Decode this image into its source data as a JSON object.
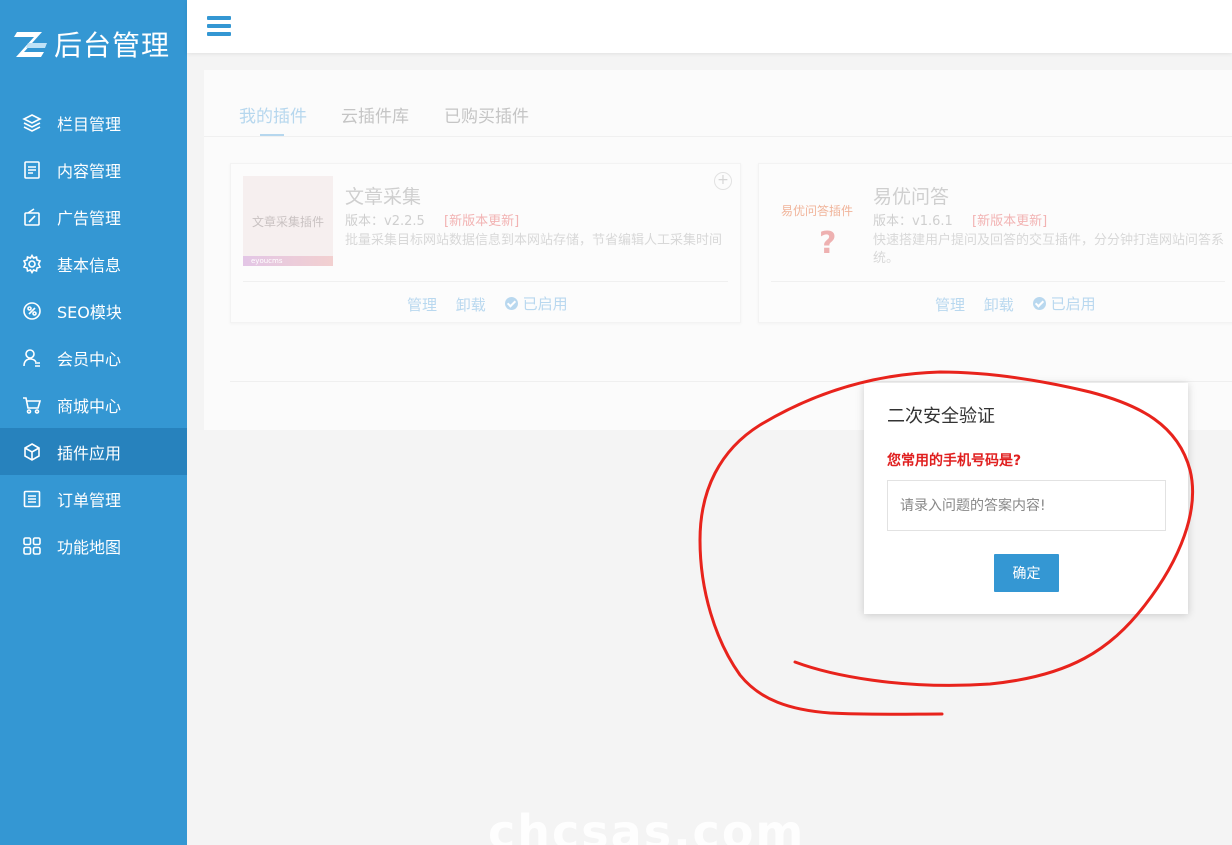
{
  "brand": {
    "text": "后台管理",
    "accent": "#3497d3"
  },
  "sidebar": {
    "active": "插件应用",
    "items": [
      {
        "label": "栏目管理",
        "icon": "layers-icon"
      },
      {
        "label": "内容管理",
        "icon": "document-icon"
      },
      {
        "label": "广告管理",
        "icon": "ad-icon"
      },
      {
        "label": "基本信息",
        "icon": "gear-icon"
      },
      {
        "label": "SEO模块",
        "icon": "seo-icon"
      },
      {
        "label": "会员中心",
        "icon": "user-icon"
      },
      {
        "label": "商城中心",
        "icon": "cart-icon"
      },
      {
        "label": "插件应用",
        "icon": "cube-icon"
      },
      {
        "label": "订单管理",
        "icon": "list-icon"
      },
      {
        "label": "功能地图",
        "icon": "grid-icon"
      }
    ]
  },
  "tabs": [
    {
      "label": "我的插件",
      "active": true
    },
    {
      "label": "云插件库",
      "active": false
    },
    {
      "label": "已购买插件",
      "active": false
    }
  ],
  "plugins": [
    {
      "thumb_text": "文章采集插件",
      "thumb_footer": "eyoucms",
      "title": "文章采集",
      "version": "版本：v2.2.5",
      "update": "[新版本更新]",
      "description": "批量采集目标网站数据信息到本网站存储，节省编辑人工采集时间",
      "add": "+",
      "actions": {
        "manage": "管理",
        "uninstall": "卸载",
        "enabled": "已启用"
      }
    },
    {
      "thumb_text": "易优问答插件",
      "title": "易优问答",
      "version": "版本：v1.6.1",
      "update": "[新版本更新]",
      "description": "快速搭建用户提问及回答的交互插件，分分钟打造网站问答系统。",
      "actions": {
        "manage": "管理",
        "uninstall": "卸载",
        "enabled": "已启用"
      }
    }
  ],
  "modal": {
    "title": "二次安全验证",
    "question": "您常用的手机号码是?",
    "input_placeholder": "请录入问题的答案内容!",
    "input_value": "",
    "confirm_label": "确定"
  },
  "annotation": {
    "color": "#e8231c"
  },
  "watermark": "chcsas.com"
}
